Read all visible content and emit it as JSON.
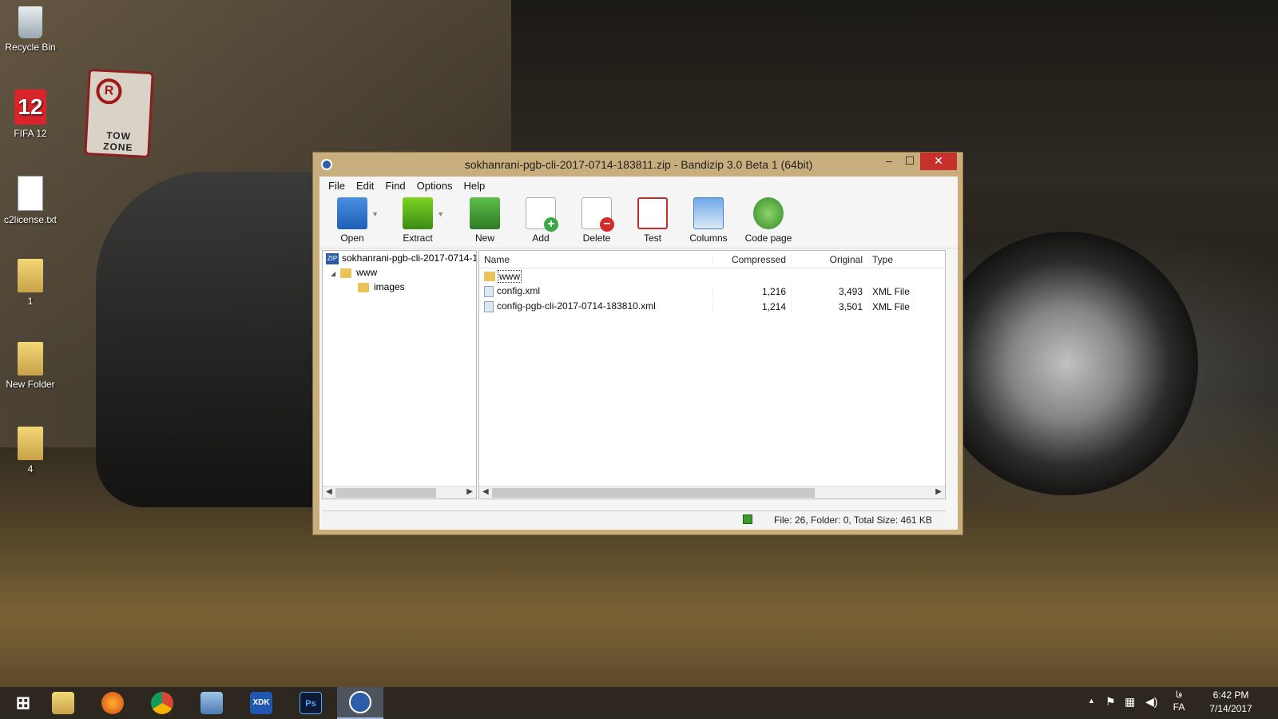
{
  "desktop": {
    "icons": [
      {
        "label": "Recycle Bin"
      },
      {
        "label": "FIFA 12"
      },
      {
        "label": "c2license.txt"
      },
      {
        "label": "1"
      },
      {
        "label": "New Folder"
      },
      {
        "label": "4"
      }
    ],
    "sign": {
      "symbol": "R",
      "text": "TOW ZONE"
    },
    "fifa_badge": "12"
  },
  "window": {
    "title": "sokhanrani-pgb-cli-2017-0714-183811.zip - Bandizip 3.0 Beta 1 (64bit)",
    "controls": {
      "minimize": "–",
      "maximize": "☐",
      "close": "✕"
    },
    "menu": [
      "File",
      "Edit",
      "Find",
      "Options",
      "Help"
    ],
    "toolbar": [
      {
        "label": "Open",
        "icon": "open-icon"
      },
      {
        "label": "Extract",
        "icon": "extract-icon"
      },
      {
        "label": "New",
        "icon": "new-archive-icon"
      },
      {
        "label": "Add",
        "icon": "add-icon"
      },
      {
        "label": "Delete",
        "icon": "delete-icon"
      },
      {
        "label": "Test",
        "icon": "test-icon"
      },
      {
        "label": "Columns",
        "icon": "columns-icon"
      },
      {
        "label": "Code page",
        "icon": "globe-icon"
      }
    ],
    "tree": {
      "root": "sokhanrani-pgb-cli-2017-0714-1",
      "children": [
        {
          "label": "www",
          "expander": "◢"
        },
        {
          "label": "images"
        }
      ]
    },
    "list": {
      "columns": {
        "name": "Name",
        "compressed": "Compressed",
        "original": "Original",
        "type": "Type"
      },
      "rows": [
        {
          "name": "www",
          "compressed": "",
          "original": "",
          "type": ""
        },
        {
          "name": "config.xml",
          "compressed": "1,216",
          "original": "3,493",
          "type": "XML File"
        },
        {
          "name": "config-pgb-cli-2017-0714-183810.xml",
          "compressed": "1,214",
          "original": "3,501",
          "type": "XML File"
        }
      ]
    },
    "status": "File: 26, Folder: 0, Total Size: 461 KB"
  },
  "taskbar": {
    "apps": [
      "Start",
      "File Explorer",
      "Firefox",
      "Chrome",
      "Control Panel",
      "Intel XDK",
      "Photoshop",
      "Bandizip"
    ],
    "xdk_label": "XDK",
    "ps_label": "Ps",
    "tray": {
      "arrow": "▲",
      "lang_script": "فا",
      "lang": "FA",
      "time": "6:42 PM",
      "date": "7/14/2017"
    }
  }
}
